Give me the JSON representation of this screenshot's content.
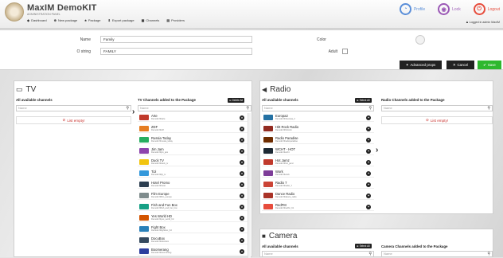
{
  "app": {
    "title": "MaxIM DemoKIT",
    "subtitle": "ADMINISTRATION PANEL"
  },
  "nav": [
    {
      "icon": "dashboard-icon",
      "glyph": "◆",
      "label": "Dashboard"
    },
    {
      "icon": "plus-icon",
      "glyph": "⊕",
      "label": "New package"
    },
    {
      "icon": "package-icon",
      "glyph": "♣",
      "label": "Package"
    },
    {
      "icon": "export-icon",
      "glyph": "⬇",
      "label": "Export package"
    },
    {
      "icon": "channels-icon",
      "glyph": "▦",
      "label": "Channels"
    },
    {
      "icon": "providers-icon",
      "glyph": "▤",
      "label": "Providers"
    }
  ],
  "topright": {
    "profile": "Profile",
    "lock": "Lock",
    "logout": "Logout",
    "logged_in": "Logged in admin MaxIM"
  },
  "colors": {
    "profile": "#5b8fd9",
    "lock": "#9b59b6",
    "logout": "#e74c3c",
    "save": "#2eb82e",
    "dark_btn": "#222222",
    "alert": "#c9302c"
  },
  "form": {
    "name_label": "Name",
    "name_value": "Family",
    "ostring_label": "O string",
    "ostring_value": "FAMILY",
    "color_label": "Color",
    "adult_label": "Adult",
    "advanced_label": "Advanced props",
    "cancel_label": "Cancel",
    "save_label": "Save"
  },
  "tv": {
    "title": "TV",
    "available_header": "All available channels",
    "search_placeholder": "Name",
    "empty_text": "List empty!",
    "added_header": "TV Channels added to the Package",
    "delete_all": "Delete All",
    "added_search_placeholder": "Name",
    "channels": [
      {
        "name": "Arte",
        "sub": "Demokit 6ltarte",
        "color": "#c0392b"
      },
      {
        "name": "ZDF",
        "sub": "Demokit 6lzdf",
        "color": "#e67e22"
      },
      {
        "name": "Russia Today",
        "sub": "Demokit 6lrussia_today",
        "color": "#27ae60"
      },
      {
        "name": "Jim Jam",
        "sub": "Demokit 6ljim_jam",
        "color": "#8e44ad"
      },
      {
        "name": "Duck TV",
        "sub": "Demokit 6lduck_tv",
        "color": "#f1c40f"
      },
      {
        "name": "TiJi",
        "sub": "Demokit 6ltiji_tv",
        "color": "#3498db"
      },
      {
        "name": "Hotel Promo",
        "sub": "Demokit 6lhotel",
        "color": "#2c3e50"
      },
      {
        "name": "Film Europe",
        "sub": "Demokit 6lfilm_europe",
        "color": "#7f8c8d"
      },
      {
        "name": "Fish and Fun Box",
        "sub": "Demokit 6lfish_and_fun_box",
        "color": "#16a085"
      },
      {
        "name": "Yes World HD",
        "sub": "Demokit 6lyes_world_hd",
        "color": "#d35400"
      },
      {
        "name": "Fight Box",
        "sub": "Demokit 6lfightbox_hd",
        "color": "#2980b9"
      },
      {
        "name": "DocuBox",
        "sub": "Demokit 6ldocubox",
        "color": "#34495e"
      },
      {
        "name": "Boomerang",
        "sub": "Demokit 6lboomerang",
        "color": "#2c3e9e"
      }
    ]
  },
  "radio": {
    "title": "Radio",
    "available_header": "All available channels",
    "select_all": "Select All",
    "search_placeholder": "Name",
    "added_header": "Radio Channels added to the Package",
    "added_search_placeholder": "Name",
    "empty_text": "List empty!",
    "channels": [
      {
        "name": "Europa2",
        "sub": "Demokit 6lrfeuropa_2",
        "color": "#2471a3"
      },
      {
        "name": "Hitt Rock Radio",
        "sub": "Demokit 6lhittrock",
        "color": "#922b21"
      },
      {
        "name": "Radio Paradise",
        "sub": "Demokit 6lradioparadise",
        "color": "#6e2c00"
      },
      {
        "name": "WCHT - HOT",
        "sub": "Demokit 6lwcht",
        "color": "#1c2833"
      },
      {
        "name": "Hot Jamz",
        "sub": "Demokit 6lhot_jamz",
        "color": "#c0392b"
      },
      {
        "name": "Work",
        "sub": "Demokit 6lwork",
        "color": "#7d3c98"
      },
      {
        "name": "Radio 7",
        "sub": "Demokit 6lradio_7",
        "color": "#cb4335"
      },
      {
        "name": "Dance Radio",
        "sub": "Demokit 6ldance_radio",
        "color": "#a93226"
      },
      {
        "name": "RedFM",
        "sub": "Demokit 6lredfm_hit",
        "color": "#e74c3c"
      }
    ]
  },
  "camera": {
    "title": "Camera",
    "available_header": "All available channels",
    "select_all": "Select All",
    "search_placeholder": "Name",
    "added_header": "Camera Channels added to the Package",
    "added_search_placeholder": "Name"
  }
}
